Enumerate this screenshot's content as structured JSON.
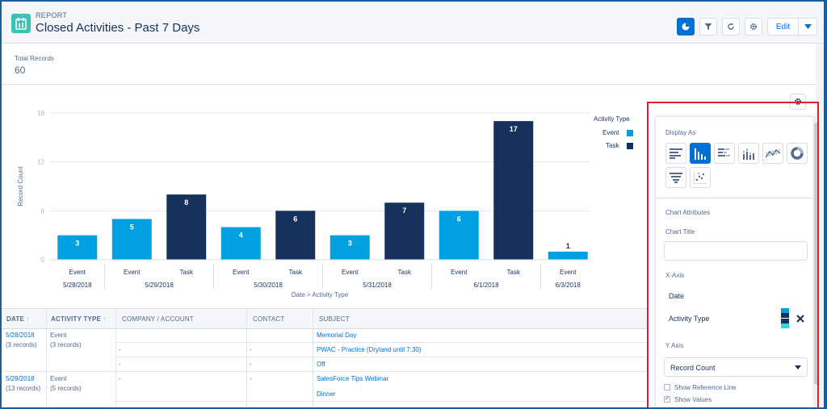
{
  "header": {
    "eyebrow": "REPORT",
    "title": "Closed Activities - Past 7 Days",
    "edit_label": "Edit"
  },
  "summary": {
    "total_label": "Total Records",
    "total_value": "60"
  },
  "chart_data": {
    "type": "bar",
    "ylabel": "Record Count",
    "xlabel": "Date > Activity Type",
    "ylim": [
      0,
      18
    ],
    "yticks": [
      "0",
      "6",
      "12",
      "18"
    ],
    "legend_title": "Activity Type",
    "legend_position": "top-right",
    "series": [
      {
        "name": "Event",
        "color": "#00a1e0"
      },
      {
        "name": "Task",
        "color": "#16325c"
      }
    ],
    "groups": [
      {
        "date": "5/28/2018",
        "bars": [
          {
            "type": "Event",
            "value": 3
          }
        ]
      },
      {
        "date": "5/29/2018",
        "bars": [
          {
            "type": "Event",
            "value": 5
          },
          {
            "type": "Task",
            "value": 8
          }
        ]
      },
      {
        "date": "5/30/2018",
        "bars": [
          {
            "type": "Event",
            "value": 4
          },
          {
            "type": "Task",
            "value": 6
          }
        ]
      },
      {
        "date": "5/31/2018",
        "bars": [
          {
            "type": "Event",
            "value": 3
          },
          {
            "type": "Task",
            "value": 7
          }
        ]
      },
      {
        "date": "6/1/2018",
        "bars": [
          {
            "type": "Event",
            "value": 6
          },
          {
            "type": "Task",
            "value": 17
          }
        ]
      },
      {
        "date": "6/3/2018",
        "bars": [
          {
            "type": "Event",
            "value": 1
          }
        ]
      }
    ]
  },
  "table": {
    "columns": [
      "DATE",
      "ACTIVITY TYPE",
      "COMPANY / ACCOUNT",
      "CONTACT",
      "SUBJECT"
    ],
    "group1": {
      "date": "5/28/2018",
      "date_count": "(3 records)",
      "type": "Event",
      "type_count": "(3 records)"
    },
    "group2": {
      "date": "5/29/2018",
      "date_count": "(13 records)",
      "type": "Event",
      "type_count": "(5 records)"
    },
    "rows": [
      {
        "company": "",
        "contact": "",
        "subject": "Memorial Day"
      },
      {
        "company": "-",
        "contact": "-",
        "subject": "PWAC - Practice (Dryland until 7:30)"
      },
      {
        "company": "-",
        "contact": "-",
        "subject": "Off"
      },
      {
        "company": "-",
        "contact": "-",
        "subject": "SalesForce Tips Webinar"
      },
      {
        "company": "",
        "contact": "",
        "subject": "Dinner"
      }
    ]
  },
  "panel": {
    "display_as_label": "Display As",
    "chart_types": [
      "horizontal-bar",
      "vertical-bar",
      "stacked-horizontal-bar",
      "stacked-vertical-bar",
      "line",
      "donut",
      "funnel",
      "scatter"
    ],
    "selected_type": "vertical-bar",
    "attributes_label": "Chart Attributes",
    "chart_title_label": "Chart Title",
    "chart_title_value": "",
    "xaxis_label": "X-Axis",
    "xaxis_items": [
      "Date",
      "Activity Type"
    ],
    "yaxis_label": "Y Axis",
    "yaxis_value": "Record Count",
    "show_reference_line_label": "Show Reference Line",
    "show_reference_line": false,
    "show_values_label": "Show Values",
    "show_values": true
  }
}
